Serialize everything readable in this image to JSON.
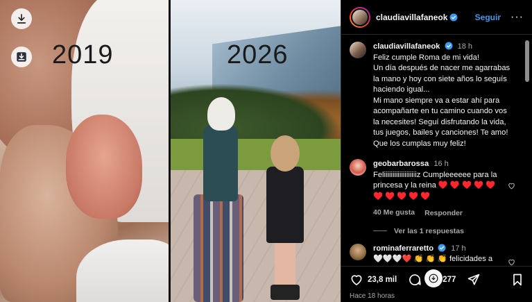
{
  "media": {
    "year_left": "2019",
    "year_right": "2026",
    "download_icon": "download-icon",
    "save_icon": "save-media-icon"
  },
  "header": {
    "username": "claudiavillafaneok",
    "follow_label": "Seguir",
    "more_label": "···",
    "accent": "#3b9bf0"
  },
  "caption": {
    "username": "claudiavillafaneok",
    "time": "18 h",
    "text": "Feliz cumple Roma de mi vida!\nUn día después de nacer me agarrabas la mano y hoy con siete años lo seguís haciendo igual...\nMi mano siempre va a  estar ahí para acompañarte en tu camino cuando vos la necesites! Seguí disfrutando la vida, tus juegos, bailes y canciones! Te amo! Que los cumplas muy feliz!"
  },
  "comments": [
    {
      "username": "geobarbarossa",
      "time": "16 h",
      "text": "Feliiiiiiiiiiiiiiiiiiiz Cumpleeeeee para la princesa y la reina ♥️ ♥️ ♥️ ♥️ ♥️ ♥️ ♥️ ♥️ ♥️ ♥️",
      "likes": "40 Me gusta",
      "reply_label": "Responder",
      "view_replies": "Ver las 1 respuestas"
    },
    {
      "username": "rominaferraretto",
      "time": "17 h",
      "text": "🤍🤍🤍❤️ 👏 👏 👏  felicidades a"
    }
  ],
  "actions": {
    "likes_count": "23,8 mil",
    "comments_count": "277",
    "timestamp": "Hace 18 horas"
  },
  "colors": {
    "background": "#000000",
    "text": "#f5f5f5",
    "muted": "#a8a8a8",
    "heart": "#ff3040"
  }
}
